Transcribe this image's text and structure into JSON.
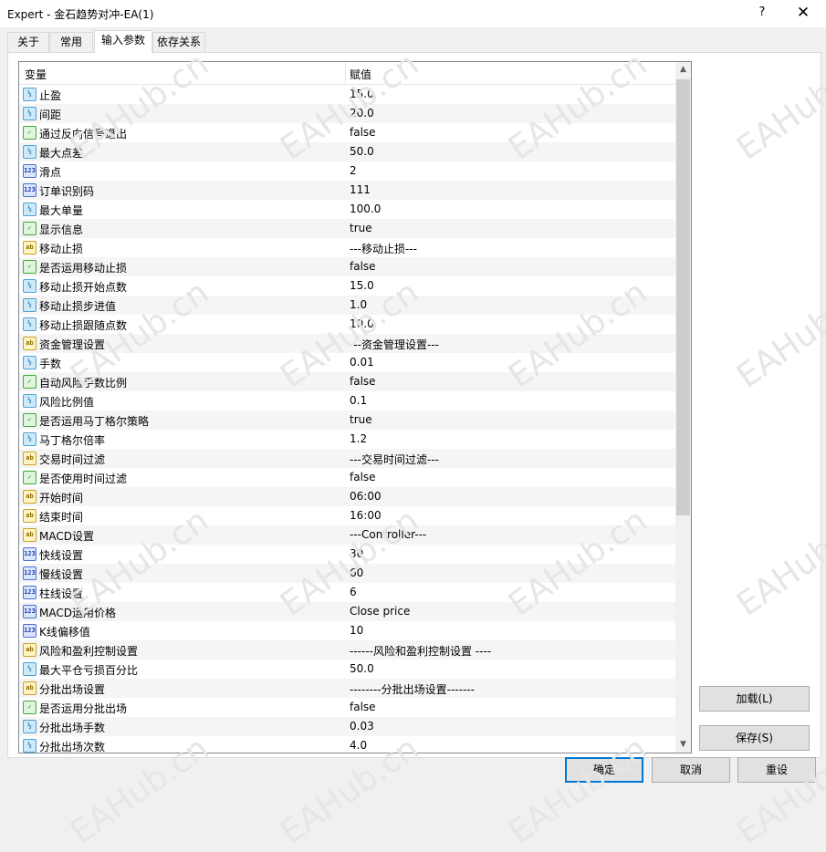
{
  "window": {
    "title": "Expert - 金石趋势对冲-EA(1)",
    "help_glyph": "?",
    "close_glyph": "✕"
  },
  "tabs": [
    {
      "label": "关于"
    },
    {
      "label": "常用"
    },
    {
      "label": "输入参数",
      "active": true
    },
    {
      "label": "依存关系"
    }
  ],
  "grid": {
    "header": {
      "variable": "变量",
      "value": "赋值"
    },
    "rows": [
      {
        "type": "dbl",
        "name": "止盈",
        "value": "15.0"
      },
      {
        "type": "dbl",
        "name": "间距",
        "value": "20.0"
      },
      {
        "type": "bool",
        "name": "通过反向信号退出",
        "value": "false"
      },
      {
        "type": "dbl",
        "name": "最大点差",
        "value": "50.0"
      },
      {
        "type": "int",
        "name": "滑点",
        "value": "2"
      },
      {
        "type": "int",
        "name": "订单识别码",
        "value": "111"
      },
      {
        "type": "dbl",
        "name": "最大单量",
        "value": "100.0"
      },
      {
        "type": "bool",
        "name": "显示信息",
        "value": "true"
      },
      {
        "type": "str",
        "name": "移动止损",
        "value": "---移动止损---"
      },
      {
        "type": "bool",
        "name": "是否运用移动止损",
        "value": "false"
      },
      {
        "type": "dbl",
        "name": "移动止损开始点数",
        "value": "15.0"
      },
      {
        "type": "dbl",
        "name": "移动止损步进值",
        "value": "1.0"
      },
      {
        "type": "dbl",
        "name": "移动止损跟随点数",
        "value": "10.0"
      },
      {
        "type": "str",
        "name": "资金管理设置",
        "value": "---资金管理设置---"
      },
      {
        "type": "dbl",
        "name": "手数",
        "value": "0.01"
      },
      {
        "type": "bool",
        "name": "自动风险手数比例",
        "value": "false"
      },
      {
        "type": "dbl",
        "name": "风险比例值",
        "value": "0.1"
      },
      {
        "type": "bool",
        "name": "是否运用马丁格尔策略",
        "value": "true"
      },
      {
        "type": "dbl",
        "name": "马丁格尔倍率",
        "value": "1.2"
      },
      {
        "type": "str",
        "name": "交易时间过滤",
        "value": "---交易时间过滤---"
      },
      {
        "type": "bool",
        "name": "是否使用时间过滤",
        "value": "false"
      },
      {
        "type": "str",
        "name": "开始时间",
        "value": "06:00"
      },
      {
        "type": "str",
        "name": "结束时间",
        "value": "16:00"
      },
      {
        "type": "str",
        "name": "MACD设置",
        "value": "---Controller---"
      },
      {
        "type": "int",
        "name": "快线设置",
        "value": "30"
      },
      {
        "type": "int",
        "name": "慢线设置",
        "value": "60"
      },
      {
        "type": "int",
        "name": "柱线设置",
        "value": "6"
      },
      {
        "type": "int",
        "name": "MACD运用价格",
        "value": "Close price"
      },
      {
        "type": "int",
        "name": "K线偏移值",
        "value": "10"
      },
      {
        "type": "str",
        "name": "风险和盈利控制设置",
        "value": "------风险和盈利控制设置 ----"
      },
      {
        "type": "dbl",
        "name": "最大平仓亏损百分比",
        "value": "50.0"
      },
      {
        "type": "str",
        "name": "分批出场设置",
        "value": "--------分批出场设置-------"
      },
      {
        "type": "bool",
        "name": "是否运用分批出场",
        "value": "false"
      },
      {
        "type": "dbl",
        "name": "分批出场手数",
        "value": "0.03"
      },
      {
        "type": "dbl",
        "name": "分批出场次数",
        "value": "4.0"
      }
    ]
  },
  "icons": {
    "dbl": {
      "glyph": "½",
      "name": "double-type-icon"
    },
    "int": {
      "glyph": "123",
      "name": "integer-type-icon"
    },
    "bool": {
      "glyph": "✓",
      "name": "bool-type-icon"
    },
    "str": {
      "glyph": "ab",
      "name": "string-type-icon"
    }
  },
  "side_buttons": {
    "load": "加载(L)",
    "save": "保存(S)"
  },
  "footer_buttons": {
    "ok": "确定",
    "cancel": "取消",
    "reset": "重设"
  },
  "watermark_text": "EAHub.cn",
  "colors": {
    "accent": "#0078d7",
    "alt_row": "#f5f5f5"
  }
}
